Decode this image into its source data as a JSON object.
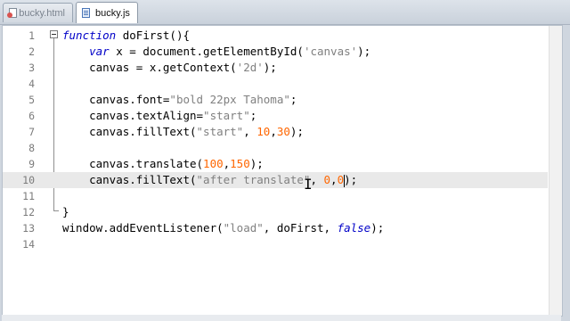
{
  "tabs": [
    {
      "label": "bucky.html",
      "icon": "html-file-icon",
      "active": false
    },
    {
      "label": "bucky.js",
      "icon": "js-file-icon",
      "active": true
    }
  ],
  "editor": {
    "current_line": 10,
    "lines": [
      {
        "n": "1",
        "code": "function doFirst(){"
      },
      {
        "n": "2",
        "code": "    var x = document.getElementById('canvas');"
      },
      {
        "n": "3",
        "code": "    canvas = x.getContext('2d');"
      },
      {
        "n": "4",
        "code": ""
      },
      {
        "n": "5",
        "code": "    canvas.font=\"bold 22px Tahoma\";"
      },
      {
        "n": "6",
        "code": "    canvas.textAlign=\"start\";"
      },
      {
        "n": "7",
        "code": "    canvas.fillText(\"start\", 10,30);"
      },
      {
        "n": "8",
        "code": ""
      },
      {
        "n": "9",
        "code": "    canvas.translate(100,150);"
      },
      {
        "n": "10",
        "code": "    canvas.fillText(\"after translate\", 0,0);"
      },
      {
        "n": "11",
        "code": ""
      },
      {
        "n": "12",
        "code": "}"
      },
      {
        "n": "13",
        "code": "window.addEventListener(\"load\", doFirst, false);"
      },
      {
        "n": "14",
        "code": ""
      }
    ]
  }
}
